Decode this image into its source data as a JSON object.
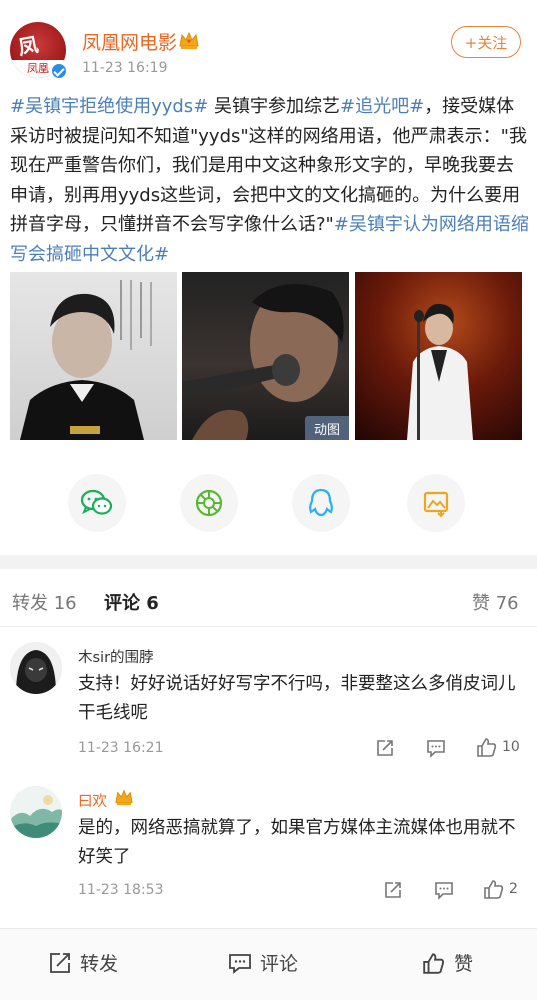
{
  "post": {
    "author": "凤凰网电影",
    "avatar_lettering": "凤凰",
    "time": "11-23 16:19",
    "follow_label": "+关注",
    "text_segments": [
      {
        "text": "#吴镇宇拒绝使用yyds#",
        "tag": true
      },
      {
        "text": " 吴镇宇参加综艺",
        "tag": false
      },
      {
        "text": "#追光吧#",
        "tag": true
      },
      {
        "text": "，接受媒体采访时被提问知不知道\"yyds\"这样的网络用语，他严肃表示：\"我现在严重警告你们，我们是用中文这种象形文字的，早晚我要去申请，别再用yyds这些词，会把中文的文化搞砸的。为什么要用拼音字母，只懂拼音不会写字像什么话?\"",
        "tag": false
      },
      {
        "text": "#吴镇宇认为网络用语缩写会搞砸中文文化#",
        "tag": true
      }
    ],
    "gif_badge": "动图"
  },
  "share_icons": [
    "wechat-icon",
    "moments-icon",
    "qq-icon",
    "save-image-icon"
  ],
  "tabs": {
    "repost": "转发 16",
    "comments": "评论 6",
    "likes": "赞 76"
  },
  "comments": [
    {
      "user": "木sir的围脖",
      "text": "支持！好好说话好好写字不行吗，非要整这么多俏皮词儿干毛线呢",
      "time": "11-23 16:21",
      "likes": "10"
    },
    {
      "user": "曰欢",
      "text": "是的，网络恶搞就算了，如果官方媒体主流媒体也用就不好笑了",
      "time": "11-23 18:53",
      "likes": "2"
    }
  ],
  "bottom_bar": {
    "repost": "转发",
    "comment": "评论",
    "like": "赞"
  },
  "colors": {
    "author_orange": "#e86722",
    "tag_blue": "#4a7fb8",
    "follow_orange": "#e9823b"
  }
}
